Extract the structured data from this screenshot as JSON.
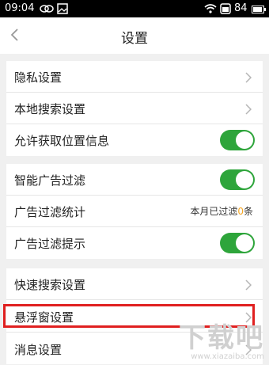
{
  "status_bar": {
    "time": "09:04",
    "battery": "84"
  },
  "header": {
    "title": "设置"
  },
  "group1": [
    {
      "label": "隐私设置",
      "control": "chevron"
    },
    {
      "label": "本地搜索设置",
      "control": "chevron"
    },
    {
      "label": "允许获取位置信息",
      "control": "toggle",
      "on": true
    }
  ],
  "group2": [
    {
      "label": "智能广告过滤",
      "control": "toggle",
      "on": true
    },
    {
      "label": "广告过滤统计",
      "control": "stat",
      "stat_prefix": "本月已过滤",
      "stat_value": "0",
      "stat_suffix": "条"
    },
    {
      "label": "广告过滤提示",
      "control": "toggle",
      "on": true
    }
  ],
  "group3": [
    {
      "label": "快速搜索设置",
      "control": "chevron"
    },
    {
      "label": "悬浮窗设置",
      "control": "chevron"
    },
    {
      "label": "消息设置",
      "control": "chevron"
    }
  ],
  "watermark": {
    "big": "下载吧",
    "small": "www.xiazaiba.com"
  },
  "colors": {
    "toggle_on": "#2ea53b",
    "highlight": "#e02020",
    "stat_number": "#f5a623"
  },
  "icons": [
    "wechat-icon",
    "image-icon",
    "wifi-icon",
    "battery-icon",
    "back-arrow-icon",
    "chevron-right-icon"
  ]
}
